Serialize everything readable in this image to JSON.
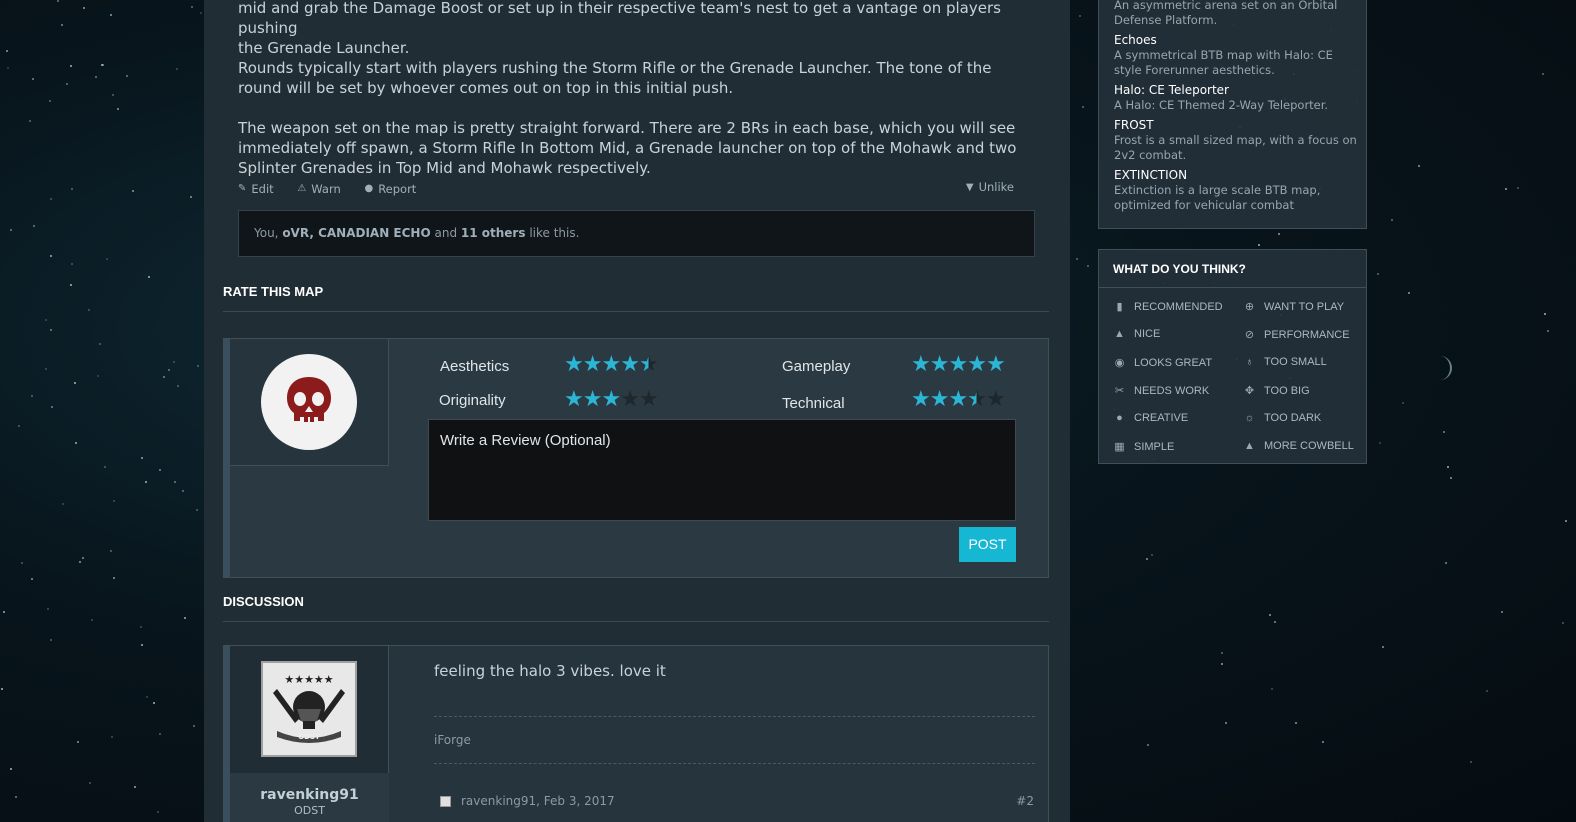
{
  "post": {
    "para_top_line1": "mid and grab the Damage Boost or set up in their respective team's nest to get a vantage on players pushing",
    "para_top_line2": "the Grenade Launcher.",
    "para2": "Rounds typically start with players rushing the Storm Rifle or the Grenade Launcher. The tone of the round will be set by whoever comes out on top in this initial push.",
    "para3": "The weapon set on the map is pretty straight forward. There are 2 BRs in each base, which you will see immediately off spawn, a Storm Rifle In Bottom Mid, a Grenade launcher on top of the Mohawk and two Splinter Grenades in Top Mid and Mohawk respectively.",
    "actions": {
      "edit": "Edit",
      "warn": "Warn",
      "report": "Report",
      "unlike": "Unlike"
    },
    "likes": {
      "you": "You, ",
      "u1": "oVR",
      "sep1": ", ",
      "u2": "CANADIAN ECHO",
      "and": " and ",
      "others": "11 others",
      "tail": " like this."
    }
  },
  "rate": {
    "title": "RATE THIS MAP",
    "ratings": [
      {
        "label": "Aesthetics",
        "value": 4.5
      },
      {
        "label": "Gameplay",
        "value": 5
      },
      {
        "label": "Originality",
        "value": 3
      },
      {
        "label": "Technical",
        "value": 3.5
      }
    ],
    "review_placeholder": "Write a Review  (Optional)",
    "post_button": "POST"
  },
  "discussion": {
    "title": "DISCUSSION",
    "message": "feeling the halo 3 vibes. love it",
    "signature": "iForge",
    "username": "ravenking91",
    "user_title": "ODST",
    "meta": "ravenking91, Feb 3, 2017",
    "post_number": "#2"
  },
  "sidebar": {
    "maps": [
      {
        "title": "",
        "desc": "An asymmetric arena set on an Orbital Defense Platform."
      },
      {
        "title": "Echoes",
        "desc": "A symmetrical BTB map with Halo: CE style Forerunner aesthetics."
      },
      {
        "title": "Halo: CE Teleporter",
        "desc": "A Halo: CE Themed 2-Way Teleporter."
      },
      {
        "title": "FROST",
        "desc": "Frost is a small sized map, with a focus on 2v2 combat."
      },
      {
        "title": "EXTINCTION",
        "desc": "Extinction is a large scale BTB map, optimized for vehicular combat"
      }
    ],
    "think_title": "WHAT DO YOU THINK?",
    "think_items": [
      "RECOMMENDED",
      "WANT TO PLAY",
      "NICE",
      "PERFORMANCE",
      "LOOKS GREAT",
      "TOO SMALL",
      "NEEDS WORK",
      "TOO BIG",
      "CREATIVE",
      "TOO DARK",
      "SIMPLE",
      "MORE COWBELL"
    ]
  },
  "colors": {
    "accent": "#16b7d3",
    "star": "#2cb6d6",
    "panel": "#212d35"
  }
}
